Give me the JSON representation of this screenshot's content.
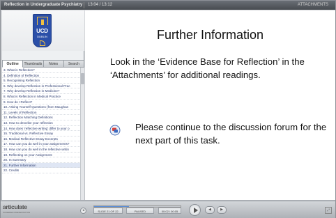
{
  "titlebar": {
    "title": "Reflection in Undergraduate Psychiatry",
    "slide_counter": "13:04 / 13:12",
    "attachments_label": "ATTACHMENTS"
  },
  "logo": {
    "text": "UCD",
    "subtext": "DUBLIN"
  },
  "sidebar": {
    "tabs": [
      "Outline",
      "Thumbnails",
      "Notes",
      "Search"
    ],
    "active_tab": "Outline",
    "items": [
      "3. What is Reflection?",
      "4. Definition of Reflection",
      "5. Recognising Reflection",
      "6. Why develop Reflection in Professional Prac",
      "7. Why develop Reflection in Medicine?",
      "8. What is Reflection in Medical Practice",
      "9. How do I Reflect?",
      "10. Asking Yourself Questions (from Maughan",
      "11. Levels of Reflection",
      "12. Reflection Matching Definitions",
      "13. How to describe your reflection",
      "14. How does 'reflective writing' differ to your o",
      "15. Traditional vs. Reflective Essay",
      "16. Medical Reflective Essay Excerpts",
      "17. How can you do well in your assignments?",
      "18. How can you do well in the reflective writin",
      "19. Reflecting on your Assignment",
      "20. In Summary",
      "21. Further Information",
      "22. Credits"
    ],
    "current_index": 18
  },
  "slide": {
    "title": "Further Information",
    "body": "Look in the ‘Evidence Base for Reflection’ in the ‘Attachments’ for additional readings.",
    "forum_text": "Please continue to the discussion forum for the next part of this task.",
    "forum_icon": "discussion-forum-icon"
  },
  "player": {
    "brand": "articulate",
    "brand_tag": "POWERED PRESENTATION",
    "slide_position": "SLIDE 21 OF 22",
    "status": "PAUSED",
    "time": "00:02 / 00:05",
    "progress": 0.4,
    "accent_color": "#5c8ed6"
  }
}
